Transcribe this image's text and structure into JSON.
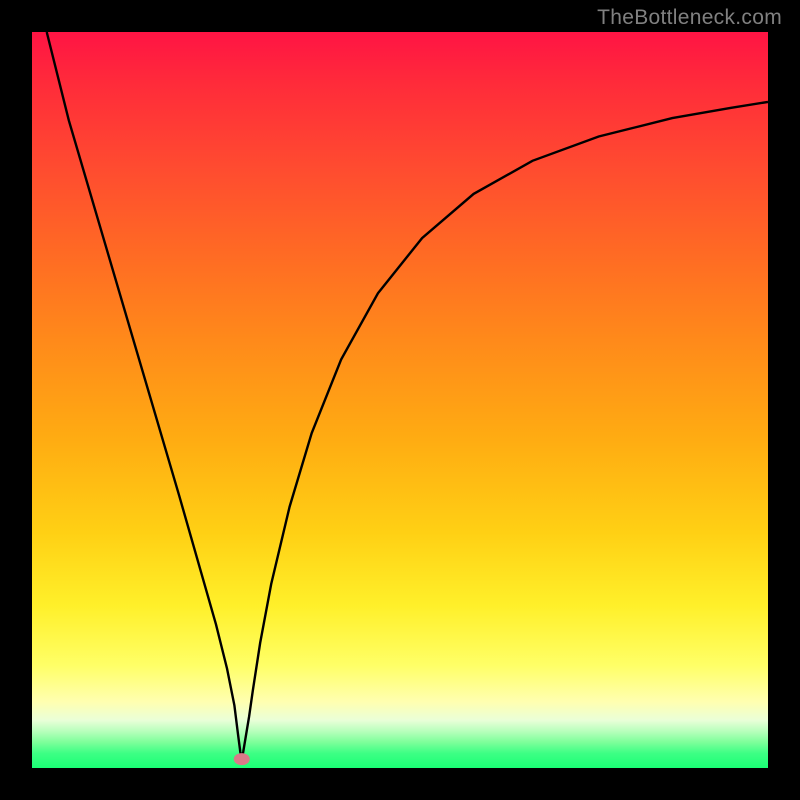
{
  "watermark": "TheBottleneck.com",
  "chart_data": {
    "type": "line",
    "title": "",
    "xlabel": "",
    "ylabel": "",
    "xlim": [
      0,
      100
    ],
    "ylim": [
      0,
      100
    ],
    "grid": false,
    "legend": false,
    "series": [
      {
        "name": "bottleneck-curve",
        "x": [
          2,
          5,
          10,
          15,
          20,
          23,
          25,
          26.5,
          27.5,
          28,
          28.3,
          28.5,
          28.7,
          29,
          29.5,
          30,
          31,
          32.5,
          35,
          38,
          42,
          47,
          53,
          60,
          68,
          77,
          87,
          95,
          100
        ],
        "values": [
          100,
          88,
          71,
          54,
          37,
          26.5,
          19.5,
          13.5,
          8.5,
          4.5,
          2.2,
          1.2,
          2.2,
          4.0,
          7.0,
          10.5,
          17.0,
          25.0,
          35.5,
          45.5,
          55.5,
          64.5,
          72.0,
          78.0,
          82.5,
          85.8,
          88.3,
          89.7,
          90.5
        ]
      }
    ],
    "marker": {
      "x": 28.5,
      "y": 1.2,
      "color": "#d97a88"
    },
    "colors": {
      "curve": "#000000",
      "background_top": "#ff1444",
      "background_bottom": "#1aff75"
    }
  }
}
